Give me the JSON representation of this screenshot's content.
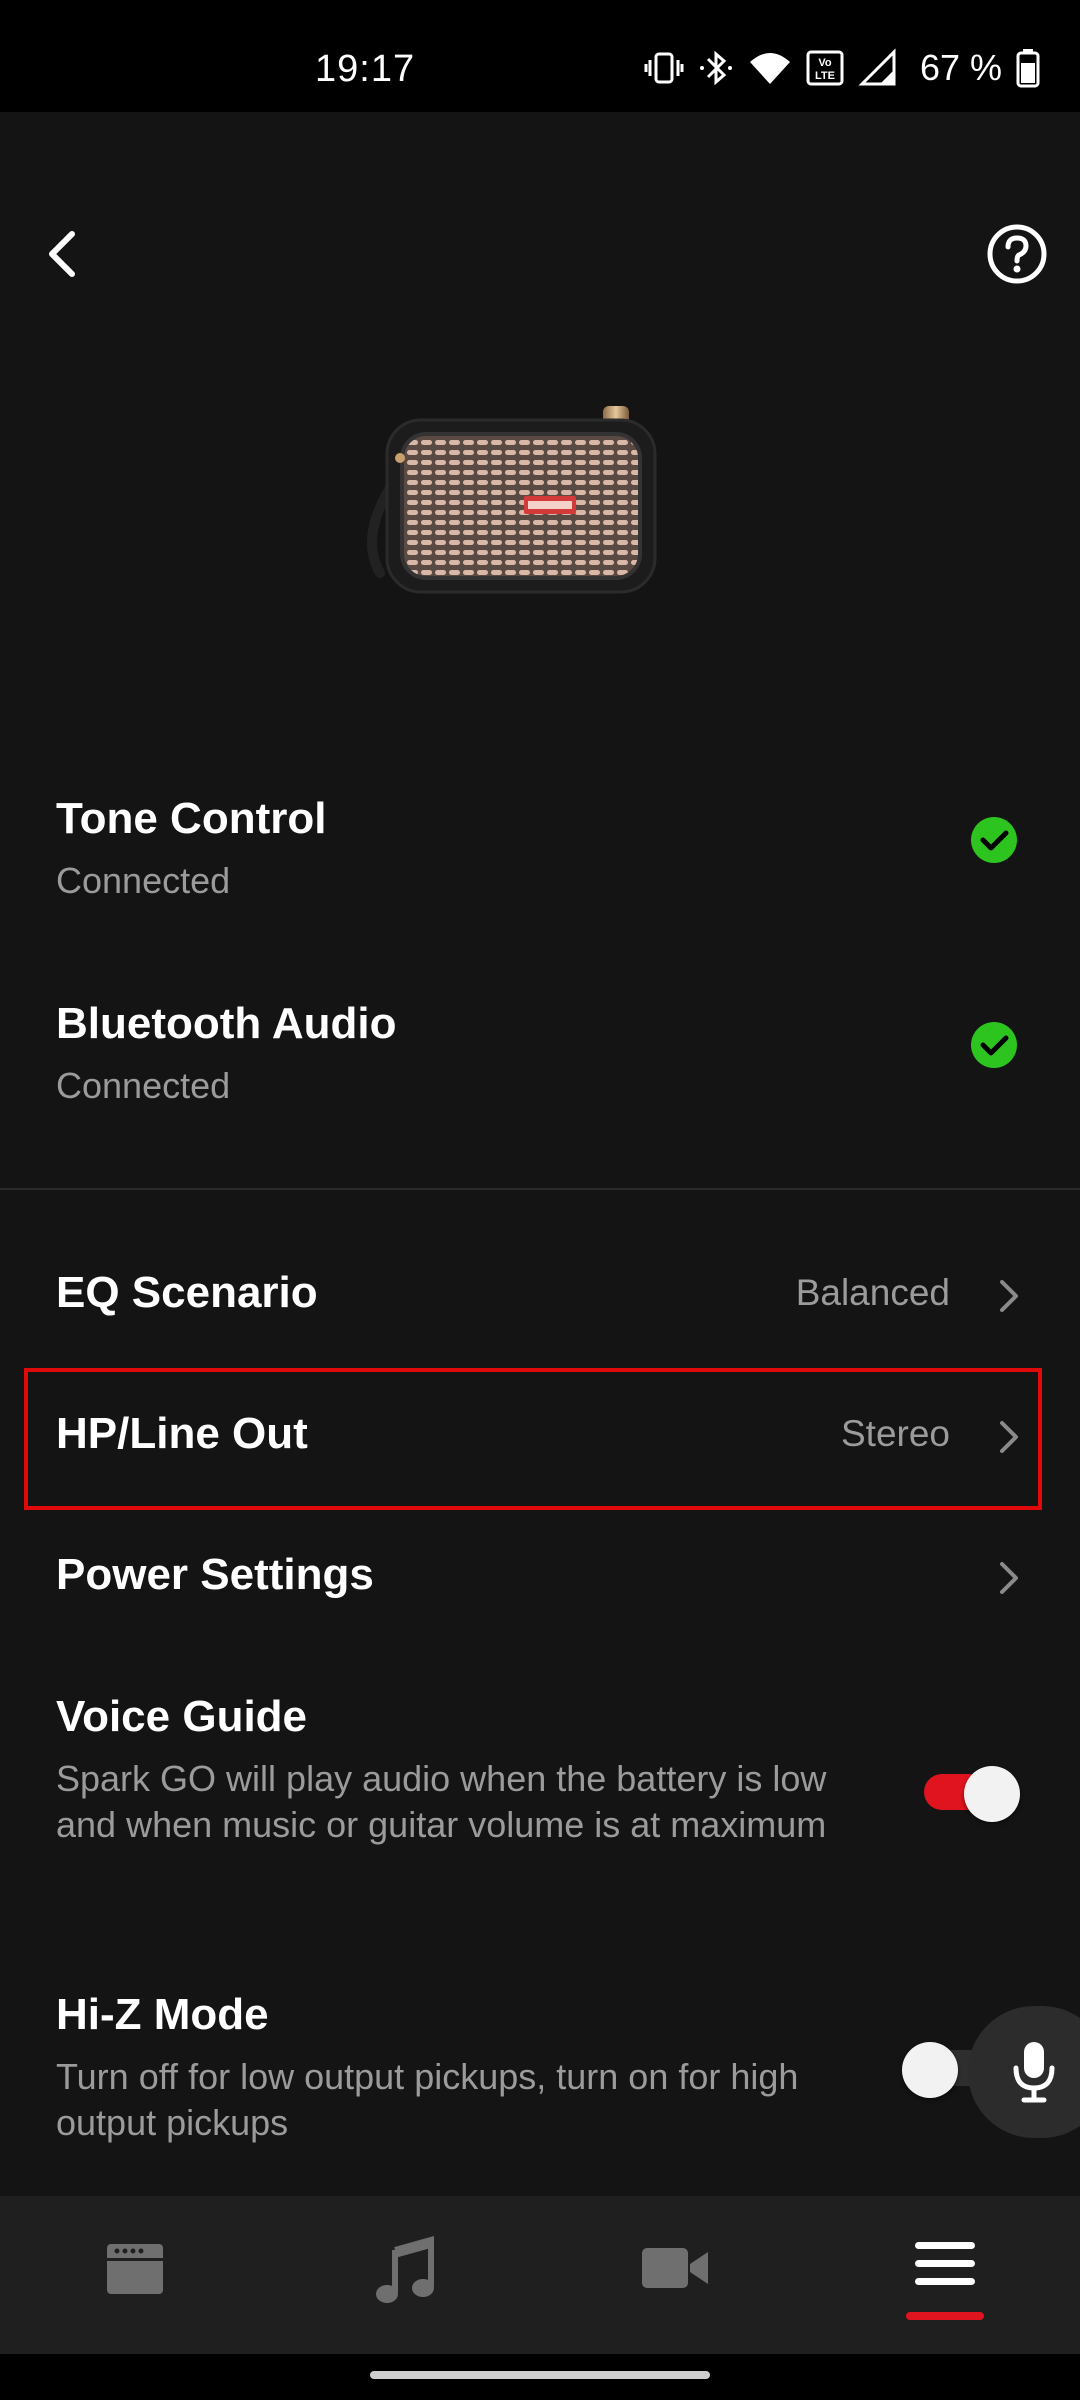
{
  "status_bar": {
    "time": "19:17",
    "battery_percent": "67 %",
    "icons": [
      "vibrate-icon",
      "bluetooth-icon",
      "wifi-icon",
      "volte-icon",
      "signal-icon",
      "battery-icon"
    ]
  },
  "header": {
    "back_icon": "chevron-left-icon",
    "help_icon": "help-circle-icon"
  },
  "device": {
    "image": "spark-go-amp-image"
  },
  "connections": [
    {
      "title": "Tone Control",
      "status": "Connected"
    },
    {
      "title": "Bluetooth Audio",
      "status": "Connected"
    }
  ],
  "menu": [
    {
      "title": "EQ Scenario",
      "value": "Balanced"
    },
    {
      "title": "HP/Line Out",
      "value": "Stereo"
    },
    {
      "title": "Power Settings",
      "value": ""
    }
  ],
  "toggles": [
    {
      "title": "Voice Guide",
      "description": "Spark GO will play audio when the battery is low and when music or guitar volume is at maximum",
      "on": true
    },
    {
      "title": "Hi-Z Mode",
      "description": "Turn off for low output pickups, turn on for high output pickups",
      "on": false
    }
  ],
  "bottom_nav": {
    "items": [
      "amp-icon",
      "music-note-icon",
      "video-camera-icon",
      "menu-icon"
    ],
    "active_index": 3
  },
  "colors": {
    "accent": "#e0141e",
    "check_green": "#2ec41f",
    "background": "#141414"
  }
}
